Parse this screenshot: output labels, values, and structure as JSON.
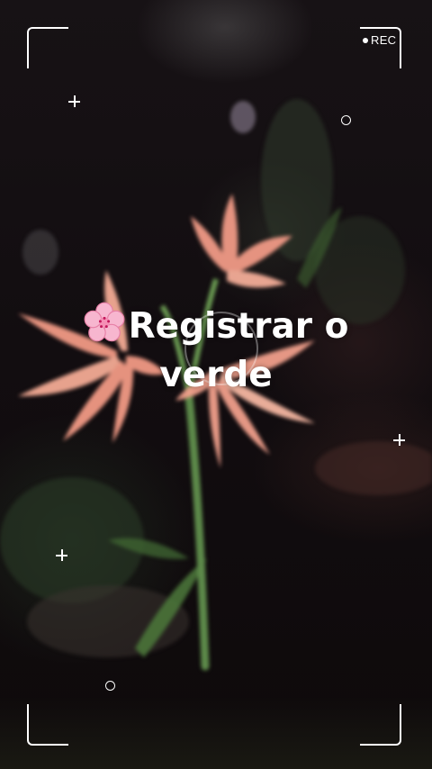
{
  "overlay": {
    "rec_label": "REC",
    "title_line1": "Registrar o",
    "title_line2": "verde",
    "title_emoji_icon": "cherry-blossom-icon"
  },
  "colors": {
    "overlay_white": "#ffffff",
    "petal_pink": "#f19a86",
    "stem_green": "#5d8a4a",
    "background_dark": "#0d0a0b"
  }
}
